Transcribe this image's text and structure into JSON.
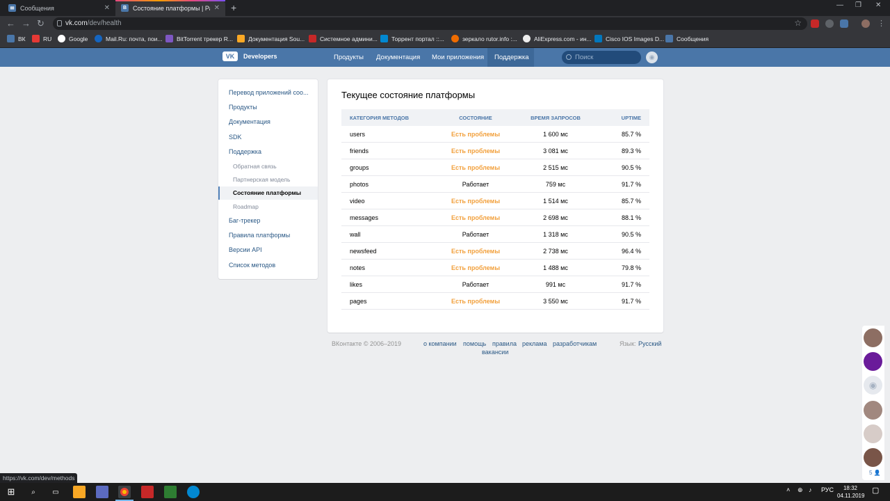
{
  "browser": {
    "tabs": [
      {
        "title": "Сообщения",
        "active": false
      },
      {
        "title": "Состояние платформы | Разработ",
        "active": true
      }
    ],
    "url_host": "vk.com",
    "url_path": "/dev/health",
    "bookmarks": [
      "ВК",
      "RU",
      "Google",
      "Mail.Ru: почта, пои...",
      "BitTorrent трекер R...",
      "Документация Sou...",
      "Системное админи...",
      "Торрент портал ::...",
      "зеркало rutor.info :...",
      "AliExpress.com - ин...",
      "Cisco IOS Images D...",
      "Сообщения"
    ],
    "status_url": "https://vk.com/dev/methods"
  },
  "vk": {
    "logo_text": "Developers",
    "nav": [
      "Продукты",
      "Документация",
      "Мои приложения",
      "Поддержка"
    ],
    "active_nav": "Поддержка",
    "search_placeholder": "Поиск"
  },
  "sidebar": {
    "items": [
      {
        "label": "Перевод приложений соо...",
        "level": 0
      },
      {
        "label": "Продукты",
        "level": 0
      },
      {
        "label": "Документация",
        "level": 0
      },
      {
        "label": "SDK",
        "level": 0
      },
      {
        "label": "Поддержка",
        "level": 0
      },
      {
        "label": "Обратная связь",
        "level": 1
      },
      {
        "label": "Партнерская модель",
        "level": 1
      },
      {
        "label": "Состояние платформы",
        "level": 1,
        "selected": true
      },
      {
        "label": "Roadmap",
        "level": 1
      },
      {
        "label": "Баг-трекер",
        "level": 0
      },
      {
        "label": "Правила платформы",
        "level": 0
      },
      {
        "label": "Версии API",
        "level": 0
      },
      {
        "label": "Список методов",
        "level": 0
      }
    ]
  },
  "health": {
    "title": "Текущее состояние платформы",
    "columns": [
      "КАТЕГОРИЯ МЕТОДОВ",
      "СОСТОЯНИЕ",
      "ВРЕМЯ ЗАПРОСОВ",
      "UPTIME"
    ],
    "rows": [
      {
        "category": "users",
        "status": "Есть проблемы",
        "status_type": "warn",
        "time": "1 600 мс",
        "uptime": "85.7 %"
      },
      {
        "category": "friends",
        "status": "Есть проблемы",
        "status_type": "warn",
        "time": "3 081 мс",
        "uptime": "89.3 %"
      },
      {
        "category": "groups",
        "status": "Есть проблемы",
        "status_type": "warn",
        "time": "2 515 мс",
        "uptime": "90.5 %"
      },
      {
        "category": "photos",
        "status": "Работает",
        "status_type": "ok",
        "time": "759 мс",
        "uptime": "91.7 %"
      },
      {
        "category": "video",
        "status": "Есть проблемы",
        "status_type": "warn",
        "time": "1 514 мс",
        "uptime": "85.7 %"
      },
      {
        "category": "messages",
        "status": "Есть проблемы",
        "status_type": "warn",
        "time": "2 698 мс",
        "uptime": "88.1 %"
      },
      {
        "category": "wall",
        "status": "Работает",
        "status_type": "ok",
        "time": "1 318 мс",
        "uptime": "90.5 %"
      },
      {
        "category": "newsfeed",
        "status": "Есть проблемы",
        "status_type": "warn",
        "time": "2 738 мс",
        "uptime": "96.4 %"
      },
      {
        "category": "notes",
        "status": "Есть проблемы",
        "status_type": "warn",
        "time": "1 488 мс",
        "uptime": "79.8 %"
      },
      {
        "category": "likes",
        "status": "Работает",
        "status_type": "ok",
        "time": "991 мс",
        "uptime": "91.7 %"
      },
      {
        "category": "pages",
        "status": "Есть проблемы",
        "status_type": "warn",
        "time": "3 550 мс",
        "uptime": "91.7 %"
      }
    ],
    "colors": {
      "warn": "#f2a03c",
      "ok": "#000000",
      "accent": "#4a76a8"
    }
  },
  "footer": {
    "copyright": "ВКонтакте © 2006–2019",
    "links": [
      "о компании",
      "помощь",
      "правила",
      "реклама",
      "разработчикам",
      "вакансии"
    ],
    "lang_label": "Язык:",
    "lang_value": "Русский"
  },
  "chat": {
    "count": "5"
  },
  "taskbar": {
    "lang": "РУС",
    "time": "18:32",
    "date": "04.11.2019"
  }
}
